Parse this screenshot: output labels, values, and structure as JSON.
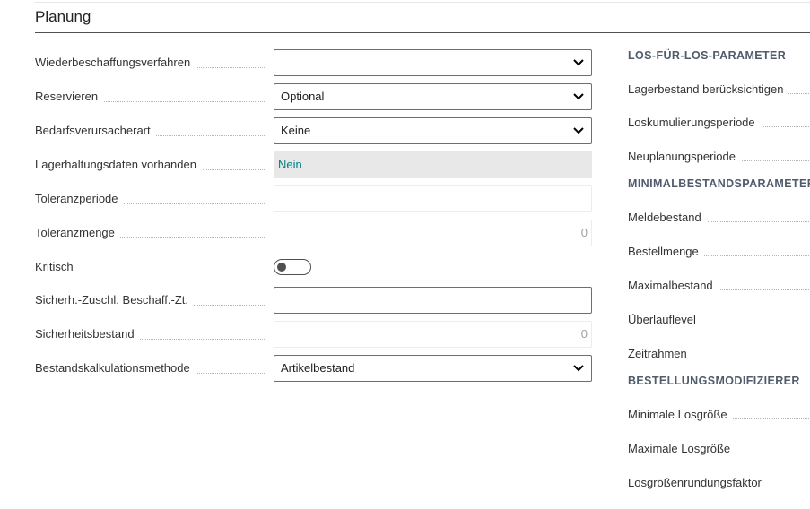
{
  "section": {
    "title": "Planung"
  },
  "fields": {
    "wiederbeschaffungsverfahren": {
      "label": "Wiederbeschaffungsverfahren",
      "value": ""
    },
    "reservieren": {
      "label": "Reservieren",
      "value": "Optional"
    },
    "bedarfsverursacherart": {
      "label": "Bedarfsverursacherart",
      "value": "Keine"
    },
    "lagerhaltungsdaten": {
      "label": "Lagerhaltungsdaten vorhanden",
      "value": "Nein"
    },
    "toleranzperiode": {
      "label": "Toleranzperiode",
      "value": ""
    },
    "toleranzmenge": {
      "label": "Toleranzmenge",
      "value": "0"
    },
    "kritisch": {
      "label": "Kritisch",
      "value": false
    },
    "sicherheitszuschlag": {
      "label": "Sicherh.-Zuschl. Beschaff.-Zt.",
      "value": ""
    },
    "sicherheitsbestand": {
      "label": "Sicherheitsbestand",
      "value": "0"
    },
    "bestandskalkulation": {
      "label": "Bestandskalkulationsmethode",
      "value": "Artikelbestand"
    }
  },
  "right": {
    "los_header": "LOS-FÜR-LOS-PARAMETER",
    "lagerbestand_beruecksichtigen": "Lagerbestand berücksichtigen",
    "loskumulierungsperiode": "Loskumulierungsperiode",
    "neuplanungsperiode": "Neuplanungsperiode",
    "minimal_header": "MINIMALBESTANDSPARAMETER",
    "meldebestand": "Meldebestand",
    "bestellmenge": "Bestellmenge",
    "maximalbestand": "Maximalbestand",
    "ueberlauflevel": "Überlauflevel",
    "zeitrahmen": "Zeitrahmen",
    "modifizierer_header": "BESTELLUNGSMODIFIZIERER",
    "minimale_losgroesse": "Minimale Losgröße",
    "maximale_losgroesse": "Maximale Losgröße",
    "losgroessenrundungsfaktor": "Losgrößenrundungsfaktor"
  },
  "colors": {
    "readonly_text": "#00807f",
    "header_text": "#505c6d",
    "readonly_bg": "#e8e8e8"
  },
  "icons": {
    "select": "chevron-down-icon"
  }
}
